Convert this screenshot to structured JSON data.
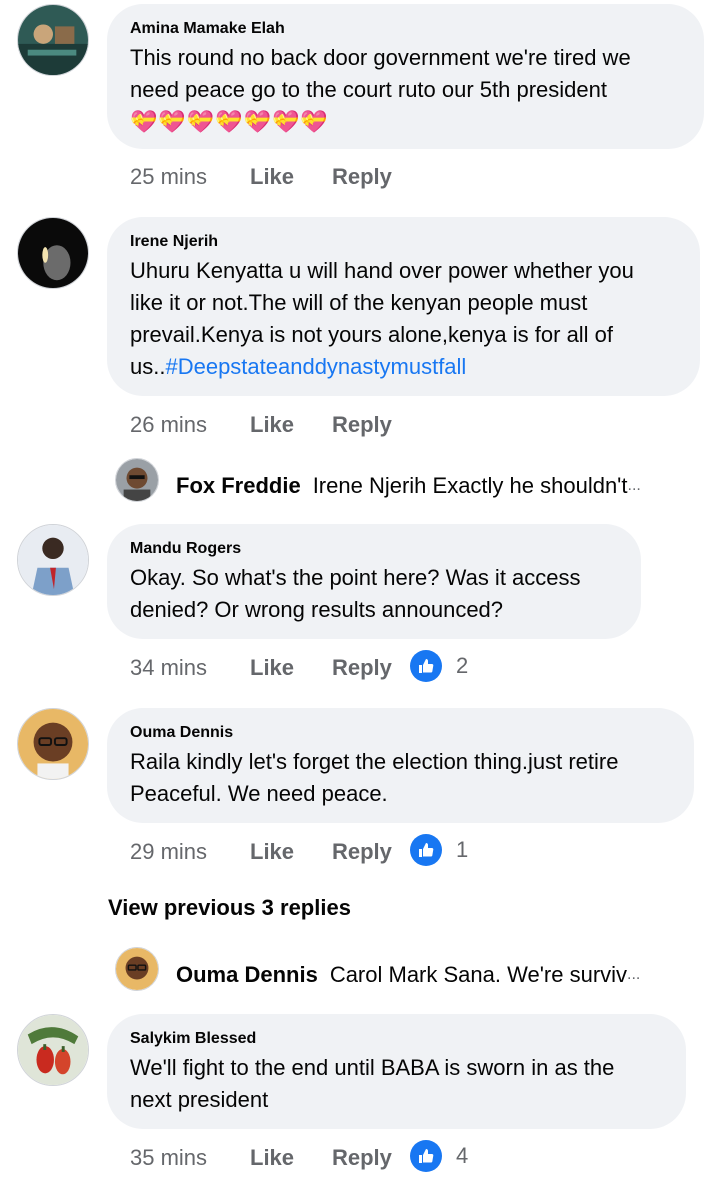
{
  "comments": [
    {
      "author": "Amina Mamake Elah",
      "line1": "This round no back door government we're tired we",
      "line2": "need peace go to the court ruto our 5th president",
      "emojis": "💝💝💝💝💝💝💝",
      "time": "25 mins",
      "like": "Like",
      "reply": "Reply"
    },
    {
      "author": "Irene Njerih",
      "line1": "Uhuru Kenyatta u will hand over power whether you",
      "line2": "like it or not.The will of the kenyan people must",
      "line3": "prevail.Kenya is not yours alone,kenya is for all of",
      "line4_prefix": "us..",
      "hashtag": "#Deepstateanddynastymustfall",
      "time": "26 mins",
      "like": "Like",
      "reply": "Reply"
    },
    {
      "author": "Mandu Rogers",
      "line1": "Okay. So what's the point here? Was it access",
      "line2": "denied? Or wrong results announced?",
      "time": "34 mins",
      "like": "Like",
      "reply": "Reply",
      "reaction_count": "2"
    },
    {
      "author": "Ouma Dennis",
      "line1": "Raila kindly let's forget the election thing.just retire",
      "line2": "Peaceful. We need peace.",
      "time": "29 mins",
      "like": "Like",
      "reply": "Reply",
      "reaction_count": "1"
    },
    {
      "author": "Salykim Blessed",
      "line1": "We'll fight to the end until BABA is sworn in as the",
      "line2": "next president",
      "time": "35 mins",
      "like": "Like",
      "reply": "Reply",
      "reaction_count": "4"
    }
  ],
  "replies": [
    {
      "name": "Fox Freddie",
      "text": "Irene Njerih Exactly he shouldn't",
      "ellipsis": "..."
    },
    {
      "name": "Ouma Dennis",
      "text": "Carol Mark Sana. We're surviv",
      "ellipsis": "..."
    }
  ],
  "view_previous": "View previous 3 replies",
  "colors": {
    "bubble": "#f0f2f5",
    "accent": "#1877f2",
    "meta": "#65676b"
  }
}
